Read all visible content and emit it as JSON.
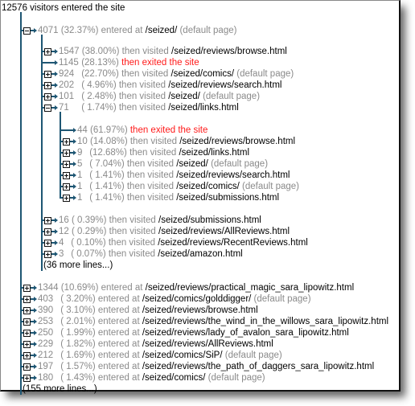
{
  "header": {
    "text": "12576 visitors entered the site"
  },
  "colors": {
    "tree_line": "#1e5673",
    "exit_text": "#ff1a1a",
    "muted_text": "#8a8a8a"
  },
  "labels": {
    "entered_at": "entered at",
    "then_visited": "then visited",
    "then_exited": "then exited the site",
    "default_page": "(default page)"
  },
  "tree": {
    "node": {
      "count": "4071",
      "pct": "(32.37%)",
      "verb": "entered at",
      "path": "/seized/",
      "note": "(default page)",
      "icon": "collapse-icon"
    },
    "children": [
      {
        "count": "1547",
        "pct": "(38.00%)",
        "verb": "then visited",
        "path": "/seized/reviews/browse.html",
        "note": "",
        "icon": "expand-icon"
      },
      {
        "count": "1145",
        "pct": "(28.13%)",
        "verb": "then exited the site",
        "path": "",
        "note": "",
        "icon": "none",
        "exit": true
      },
      {
        "count": "924",
        "pct": "(22.70%)",
        "verb": "then visited",
        "path": "/seized/comics/",
        "note": "(default page)",
        "icon": "expand-icon"
      },
      {
        "count": "202",
        "pct": "( 4.96%)",
        "verb": "then visited",
        "path": "/seized/reviews/search.html",
        "note": "",
        "icon": "expand-icon"
      },
      {
        "count": "101",
        "pct": "( 2.48%)",
        "verb": "then visited",
        "path": "/seized/",
        "note": "(default page)",
        "icon": "expand-icon"
      },
      {
        "count": "71",
        "pct": "( 1.74%)",
        "verb": "then visited",
        "path": "/seized/links.html",
        "note": "",
        "icon": "collapse-icon"
      }
    ],
    "grandchildren": [
      {
        "count": "44",
        "pct": "(61.97%)",
        "verb": "then exited the site",
        "path": "",
        "note": "",
        "icon": "none",
        "exit": true
      },
      {
        "count": "10",
        "pct": "(14.08%)",
        "verb": "then visited",
        "path": "/seized/reviews/browse.html",
        "note": "",
        "icon": "expand-icon"
      },
      {
        "count": "9",
        "pct": "(12.68%)",
        "verb": "then visited",
        "path": "/seized/links.html",
        "note": "",
        "icon": "expand-icon"
      },
      {
        "count": "5",
        "pct": "( 7.04%)",
        "verb": "then visited",
        "path": "/seized/",
        "note": "(default page)",
        "icon": "expand-icon"
      },
      {
        "count": "1",
        "pct": "( 1.41%)",
        "verb": "then visited",
        "path": "/seized/reviews/search.html",
        "note": "",
        "icon": "expand-icon"
      },
      {
        "count": "1",
        "pct": "( 1.41%)",
        "verb": "then visited",
        "path": "/seized/comics/",
        "note": "(default page)",
        "icon": "expand-icon"
      },
      {
        "count": "1",
        "pct": "( 1.41%)",
        "verb": "then visited",
        "path": "/seized/submissions.html",
        "note": "",
        "icon": "expand-icon"
      }
    ],
    "children_after": [
      {
        "count": "16",
        "pct": "( 0.39%)",
        "verb": "then visited",
        "path": "/seized/submissions.html",
        "note": "",
        "icon": "expand-icon"
      },
      {
        "count": "12",
        "pct": "( 0.29%)",
        "verb": "then visited",
        "path": "/seized/reviews/AllReviews.html",
        "note": "",
        "icon": "expand-icon"
      },
      {
        "count": "4",
        "pct": "( 0.10%)",
        "verb": "then visited",
        "path": "/seized/reviews/RecentReviews.html",
        "note": "",
        "icon": "expand-icon"
      },
      {
        "count": "3",
        "pct": "( 0.07%)",
        "verb": "then visited",
        "path": "/seized/amazon.html",
        "note": "",
        "icon": "expand-icon"
      }
    ],
    "children_more": "(36 more lines...)",
    "entries": [
      {
        "count": "1344",
        "pct": "(10.69%)",
        "verb": "entered at",
        "path": "/seized/reviews/practical_magic_sara_lipowitz.html",
        "note": "",
        "icon": "expand-icon"
      },
      {
        "count": "403",
        "pct": "( 3.20%)",
        "verb": "entered at",
        "path": "/seized/comics/golddigger/",
        "note": "(default page)",
        "icon": "expand-icon"
      },
      {
        "count": "390",
        "pct": "( 3.10%)",
        "verb": "entered at",
        "path": "/seized/reviews/browse.html",
        "note": "",
        "icon": "expand-icon"
      },
      {
        "count": "253",
        "pct": "( 2.01%)",
        "verb": "entered at",
        "path": "/seized/reviews/the_wind_in_the_willows_sara_lipowitz.html",
        "note": "",
        "icon": "expand-icon"
      },
      {
        "count": "250",
        "pct": "( 1.99%)",
        "verb": "entered at",
        "path": "/seized/reviews/lady_of_avalon_sara_lipowitz.html",
        "note": "",
        "icon": "expand-icon"
      },
      {
        "count": "229",
        "pct": "( 1.82%)",
        "verb": "entered at",
        "path": "/seized/reviews/AllReviews.html",
        "note": "",
        "icon": "expand-icon"
      },
      {
        "count": "212",
        "pct": "( 1.69%)",
        "verb": "entered at",
        "path": "/seized/comics/SiP/",
        "note": "(default page)",
        "icon": "expand-icon"
      },
      {
        "count": "197",
        "pct": "( 1.57%)",
        "verb": "entered at",
        "path": "/seized/reviews/the_path_of_daggers_sara_lipowitz.html",
        "note": "",
        "icon": "expand-icon"
      },
      {
        "count": "180",
        "pct": "( 1.43%)",
        "verb": "entered at",
        "path": "/seized/comics/",
        "note": "(default page)",
        "icon": "expand-icon"
      }
    ],
    "entries_more": "(155 more lines...)"
  }
}
